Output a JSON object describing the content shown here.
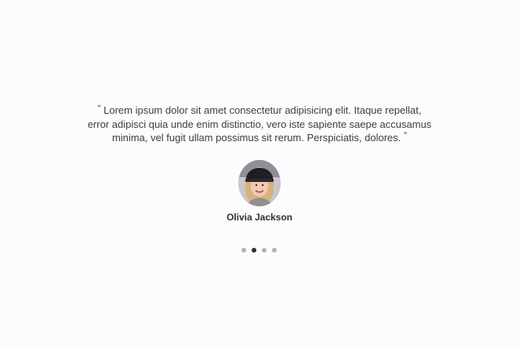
{
  "testimonial": {
    "quote_open": "“",
    "quote_text": "Lorem ipsum dolor sit amet consectetur adipisicing elit. Itaque repellat, error adipisci quia unde enim distinctio, vero iste sapiente saepe accusamus minima, vel fugit ullam possimus sit rerum. Perspiciatis, dolores.",
    "quote_close": "”",
    "author_name": "Olivia Jackson",
    "avatar_alt": "Olivia Jackson photo"
  },
  "pagination": {
    "count": 4,
    "active_index": 1
  },
  "colors": {
    "background": "#fcfbfd",
    "text": "#3d3d42",
    "dot_inactive": "#b3b3b8",
    "dot_active": "#2b2b2f"
  }
}
